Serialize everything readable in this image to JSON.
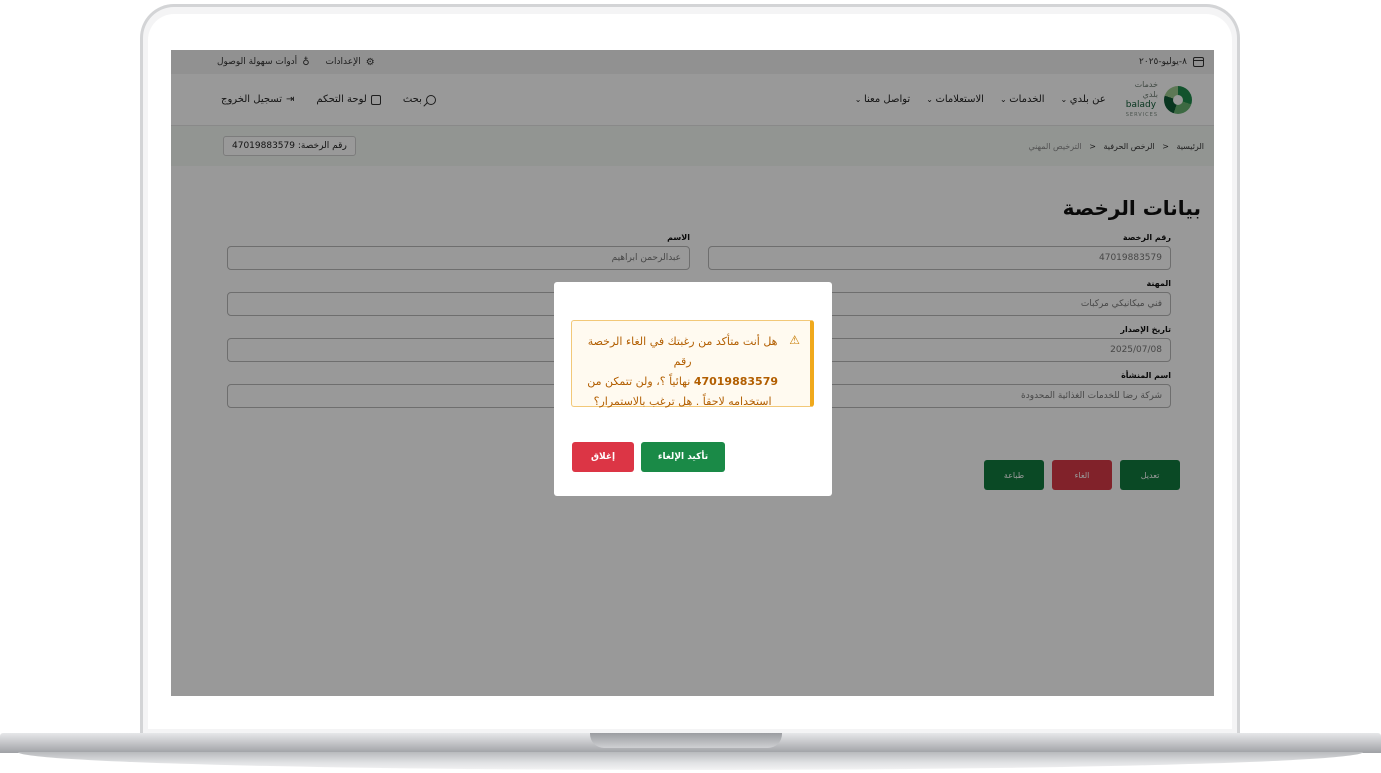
{
  "topbar": {
    "date": "٨-يوليو-٢٠٢٥",
    "settings": "الإعدادات",
    "accessibility": "أدوات سهولة الوصول"
  },
  "navbar": {
    "logo_ar": "بلدي",
    "logo_top": "خدمات",
    "logo_en": "balady",
    "logo_sub": "SERVICES",
    "menu": [
      "عن بلدي",
      "الخدمات",
      "الاستعلامات",
      "تواصل معنا"
    ],
    "search": "بحث",
    "dashboard": "لوحة التحكم",
    "logout": "تسجيل الخروج"
  },
  "breadcrumb": {
    "home": "الرئيسية",
    "licenses": "الرخص الحرفية",
    "current": "الترخيص المهني",
    "license_chip": "رقم الرخصة: 47019883579"
  },
  "page": {
    "title": "بيانات الرخصة",
    "fields": {
      "license_number_label": "رقم الرخصة",
      "license_number": "47019883579",
      "name_label": "الاسم",
      "name": "عبدالرحمن ابراهيم",
      "profession_label": "المهنة",
      "profession": "فني ميكانيكي مركبات",
      "issue_date_label": "تاريخ الإصدار",
      "issue_date": "2025/07/08",
      "establishment_label": "اسم المنشأة",
      "establishment": "شركة رضا للخدمات الغذائية المحدودة"
    },
    "actions": {
      "edit": "تعديل",
      "cancel": "الغاء",
      "print": "طباعة"
    }
  },
  "modal": {
    "line1": "هل أنت متأكد من رغبتك في الغاء الرخصة رقم",
    "line2_num": "47019883579",
    "line2_rest": "نهائياً ؟، ولن تتمكن من",
    "line3": "استخدامه لاحقاً . هل ترغب بالاستمرار؟",
    "confirm": "تأكيد الإلغاء",
    "close": "إغلاق"
  },
  "colors": {
    "brand_green": "#127a3f",
    "danger_red": "#dc3545",
    "warning_text": "#b25e00",
    "warning_border": "#f0a91c"
  }
}
